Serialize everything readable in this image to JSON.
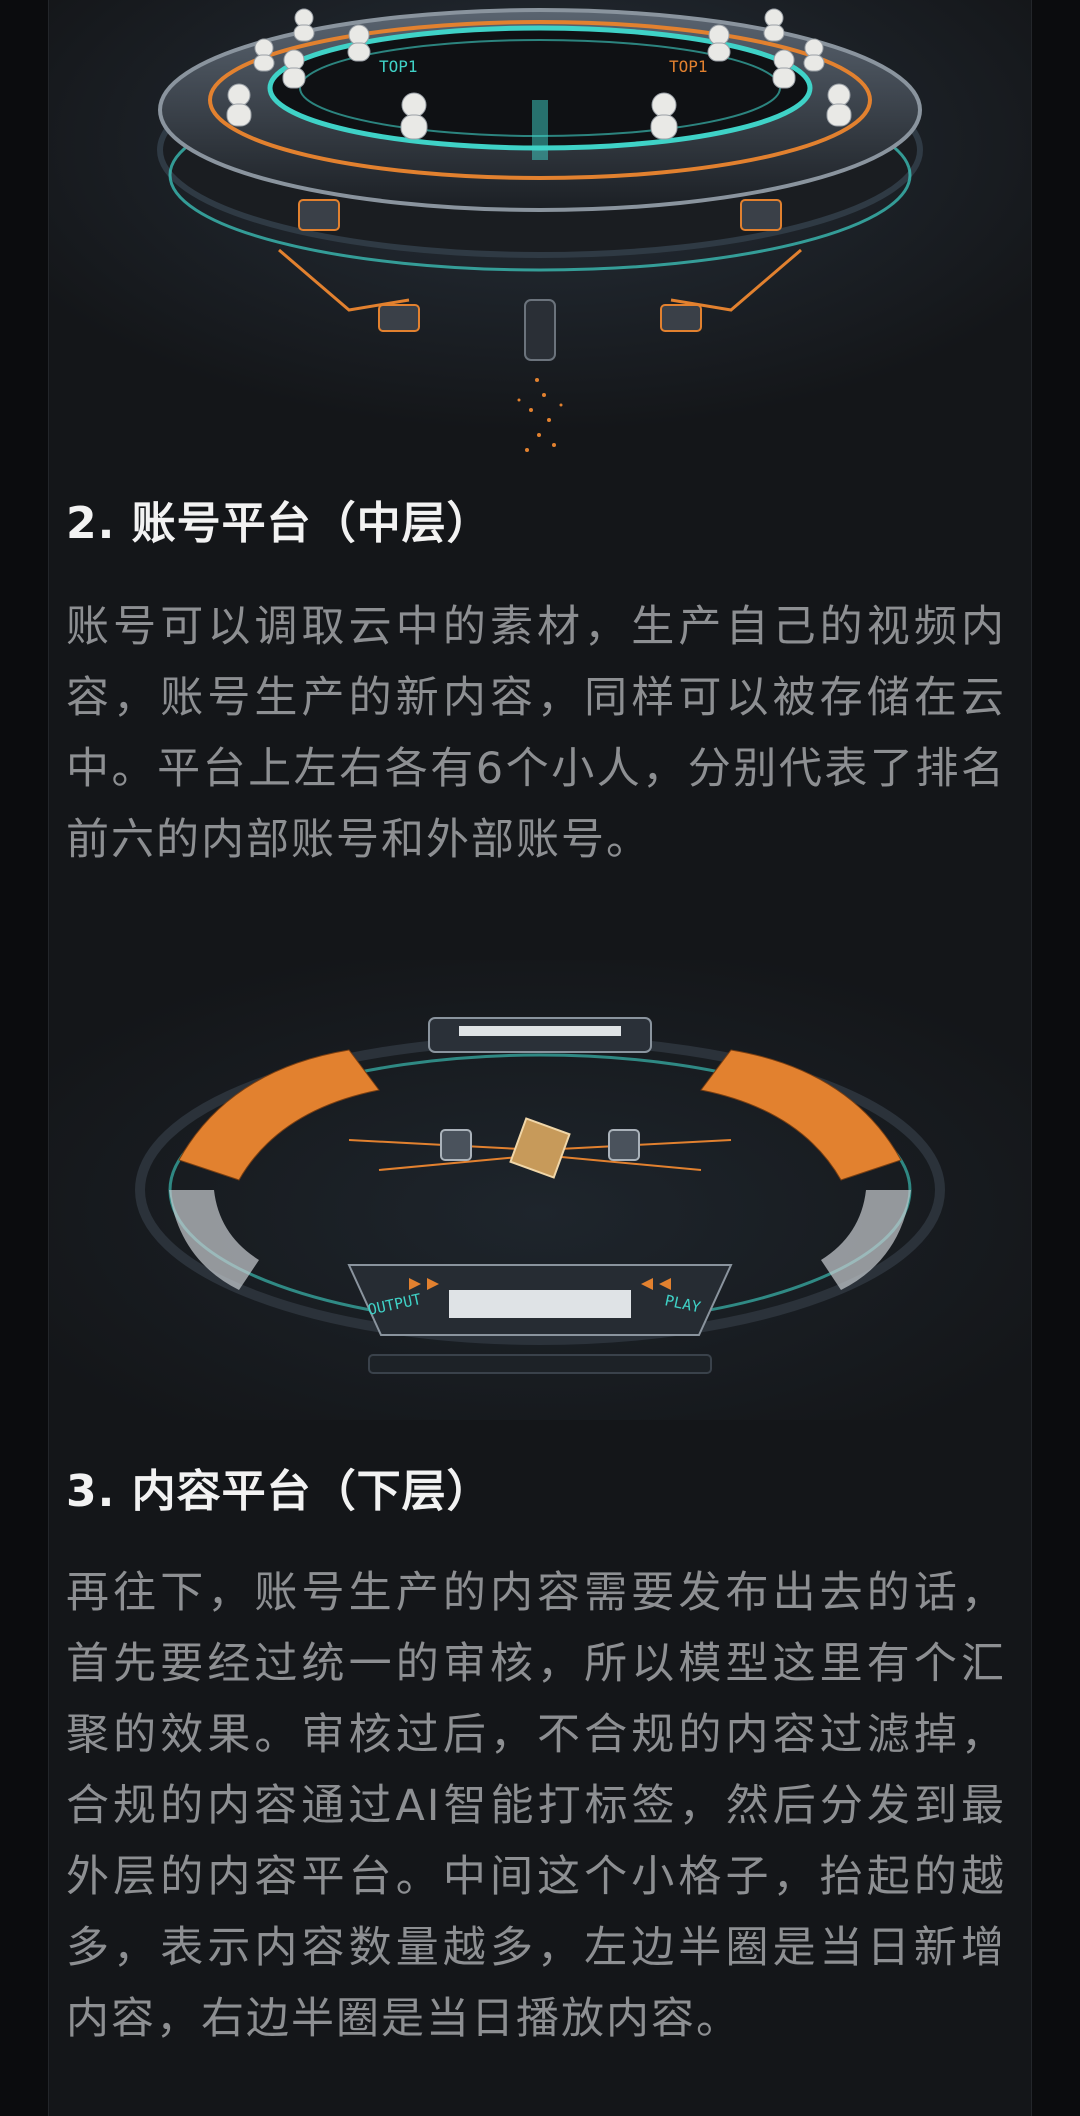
{
  "figure_top": {
    "badge_left": "TOP1",
    "badge_right": "TOP1"
  },
  "section_2": {
    "heading": "2. 账号平台（中层）",
    "body": "账号可以调取云中的素材，生产自己的视频内容，账号生产的新内容，同样可以被存储在云中。平台上左右各有6个小人，分别代表了排名前六的内部账号和外部账号。"
  },
  "figure_mid": {
    "label_left": "OUTPUT",
    "label_right": "PLAY"
  },
  "section_3": {
    "heading": "3. 内容平台（下层）",
    "body": "再往下，账号生产的内容需要发布出去的话，首先要经过统一的审核，所以模型这里有个汇聚的效果。审核过后，不合规的内容过滤掉，合规的内容通过AI智能打标签，然后分发到最外层的内容平台。中间这个小格子，抬起的越多，表示内容数量越多，左边半圈是当日新增内容，右边半圈是当日播放内容。"
  },
  "colors": {
    "accent_orange": "#e2812f",
    "accent_teal": "#3fd2c7",
    "text_heading": "#f2f2f2",
    "text_body": "#8d8f92",
    "background": "#141619"
  }
}
